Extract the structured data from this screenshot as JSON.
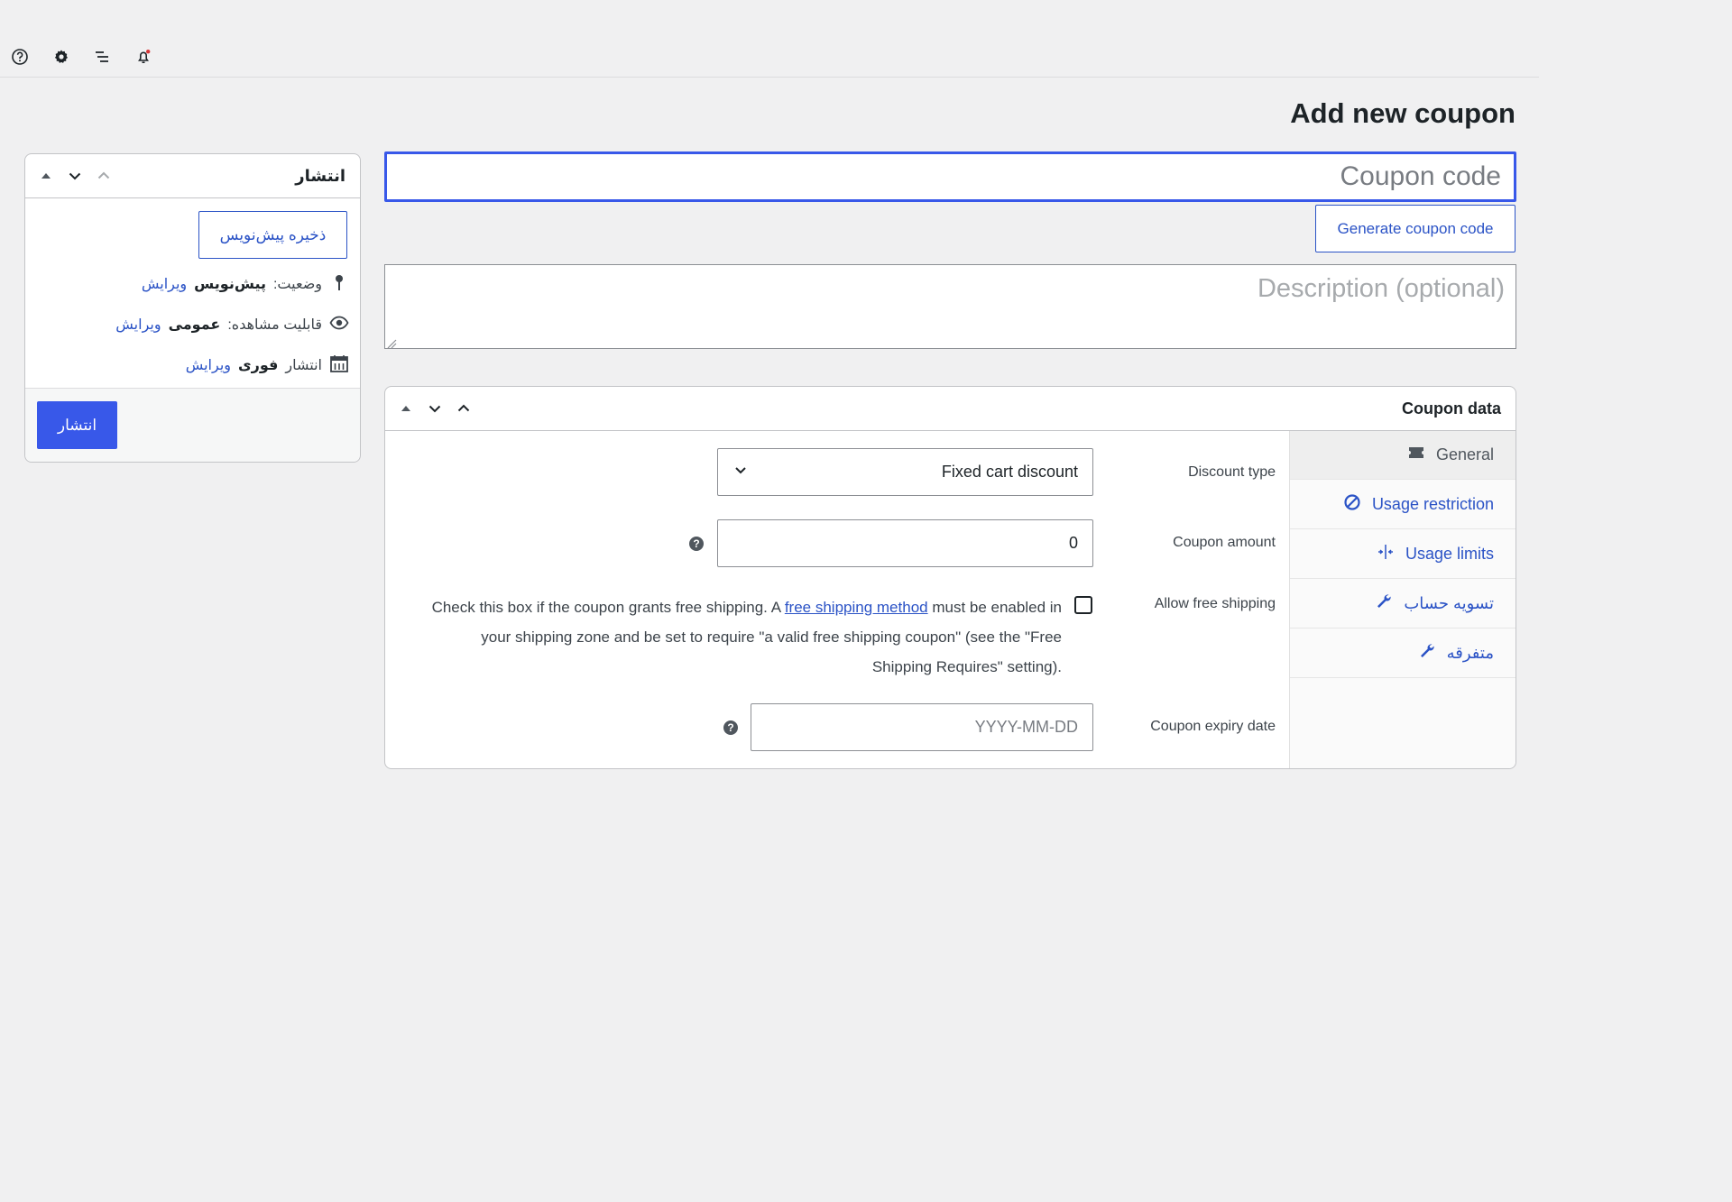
{
  "page": {
    "title": "Add new coupon"
  },
  "toolbar": {
    "icons": [
      "help-icon",
      "gear-icon",
      "activity-list-icon",
      "bell-icon"
    ]
  },
  "coupon_code": {
    "placeholder": "Coupon code",
    "value": ""
  },
  "generate_button": "Generate coupon code",
  "description": {
    "placeholder": "Description (optional)"
  },
  "publish_box": {
    "title": "انتشار",
    "save_draft": "ذخیره پیش‌نویس",
    "status_label": "وضعیت:",
    "status_value": "پیش‌نویس",
    "visibility_label": "قابلیت مشاهده:",
    "visibility_value": "عمومی",
    "publish_label": "انتشار",
    "publish_value": "فوری",
    "edit_link": "ویرایش",
    "publish_button": "انتشار"
  },
  "coupon_data": {
    "title": "Coupon data",
    "tabs": [
      {
        "label": "General",
        "icon": "ticket-icon",
        "active": true
      },
      {
        "label": "Usage restriction",
        "icon": "no-entry-icon",
        "active": false
      },
      {
        "label": "Usage limits",
        "icon": "limits-icon",
        "active": false
      },
      {
        "label": "تسویه حساب",
        "icon": "wrench-icon",
        "active": false
      },
      {
        "label": "متفرقه",
        "icon": "wrench-icon",
        "active": false
      }
    ],
    "fields": {
      "discount_type_label": "Discount type",
      "discount_type_value": "Fixed cart discount",
      "coupon_amount_label": "Coupon amount",
      "coupon_amount_value": "0",
      "free_shipping_label": "Allow free shipping",
      "free_shipping_checked": false,
      "free_shipping_desc_before": "Check this box if the coupon grants free shipping. A ",
      "free_shipping_link": "free shipping method",
      "free_shipping_desc_after": " must be enabled in your shipping zone and be set to require \"a valid free shipping coupon\" (see the \"Free Shipping Requires\" setting).",
      "expiry_label": "Coupon expiry date",
      "expiry_placeholder": "YYYY-MM-DD",
      "help_glyph": "?"
    }
  },
  "colors": {
    "accent": "#3858e9",
    "link": "#2b53c6",
    "background": "#f0f0f1"
  }
}
